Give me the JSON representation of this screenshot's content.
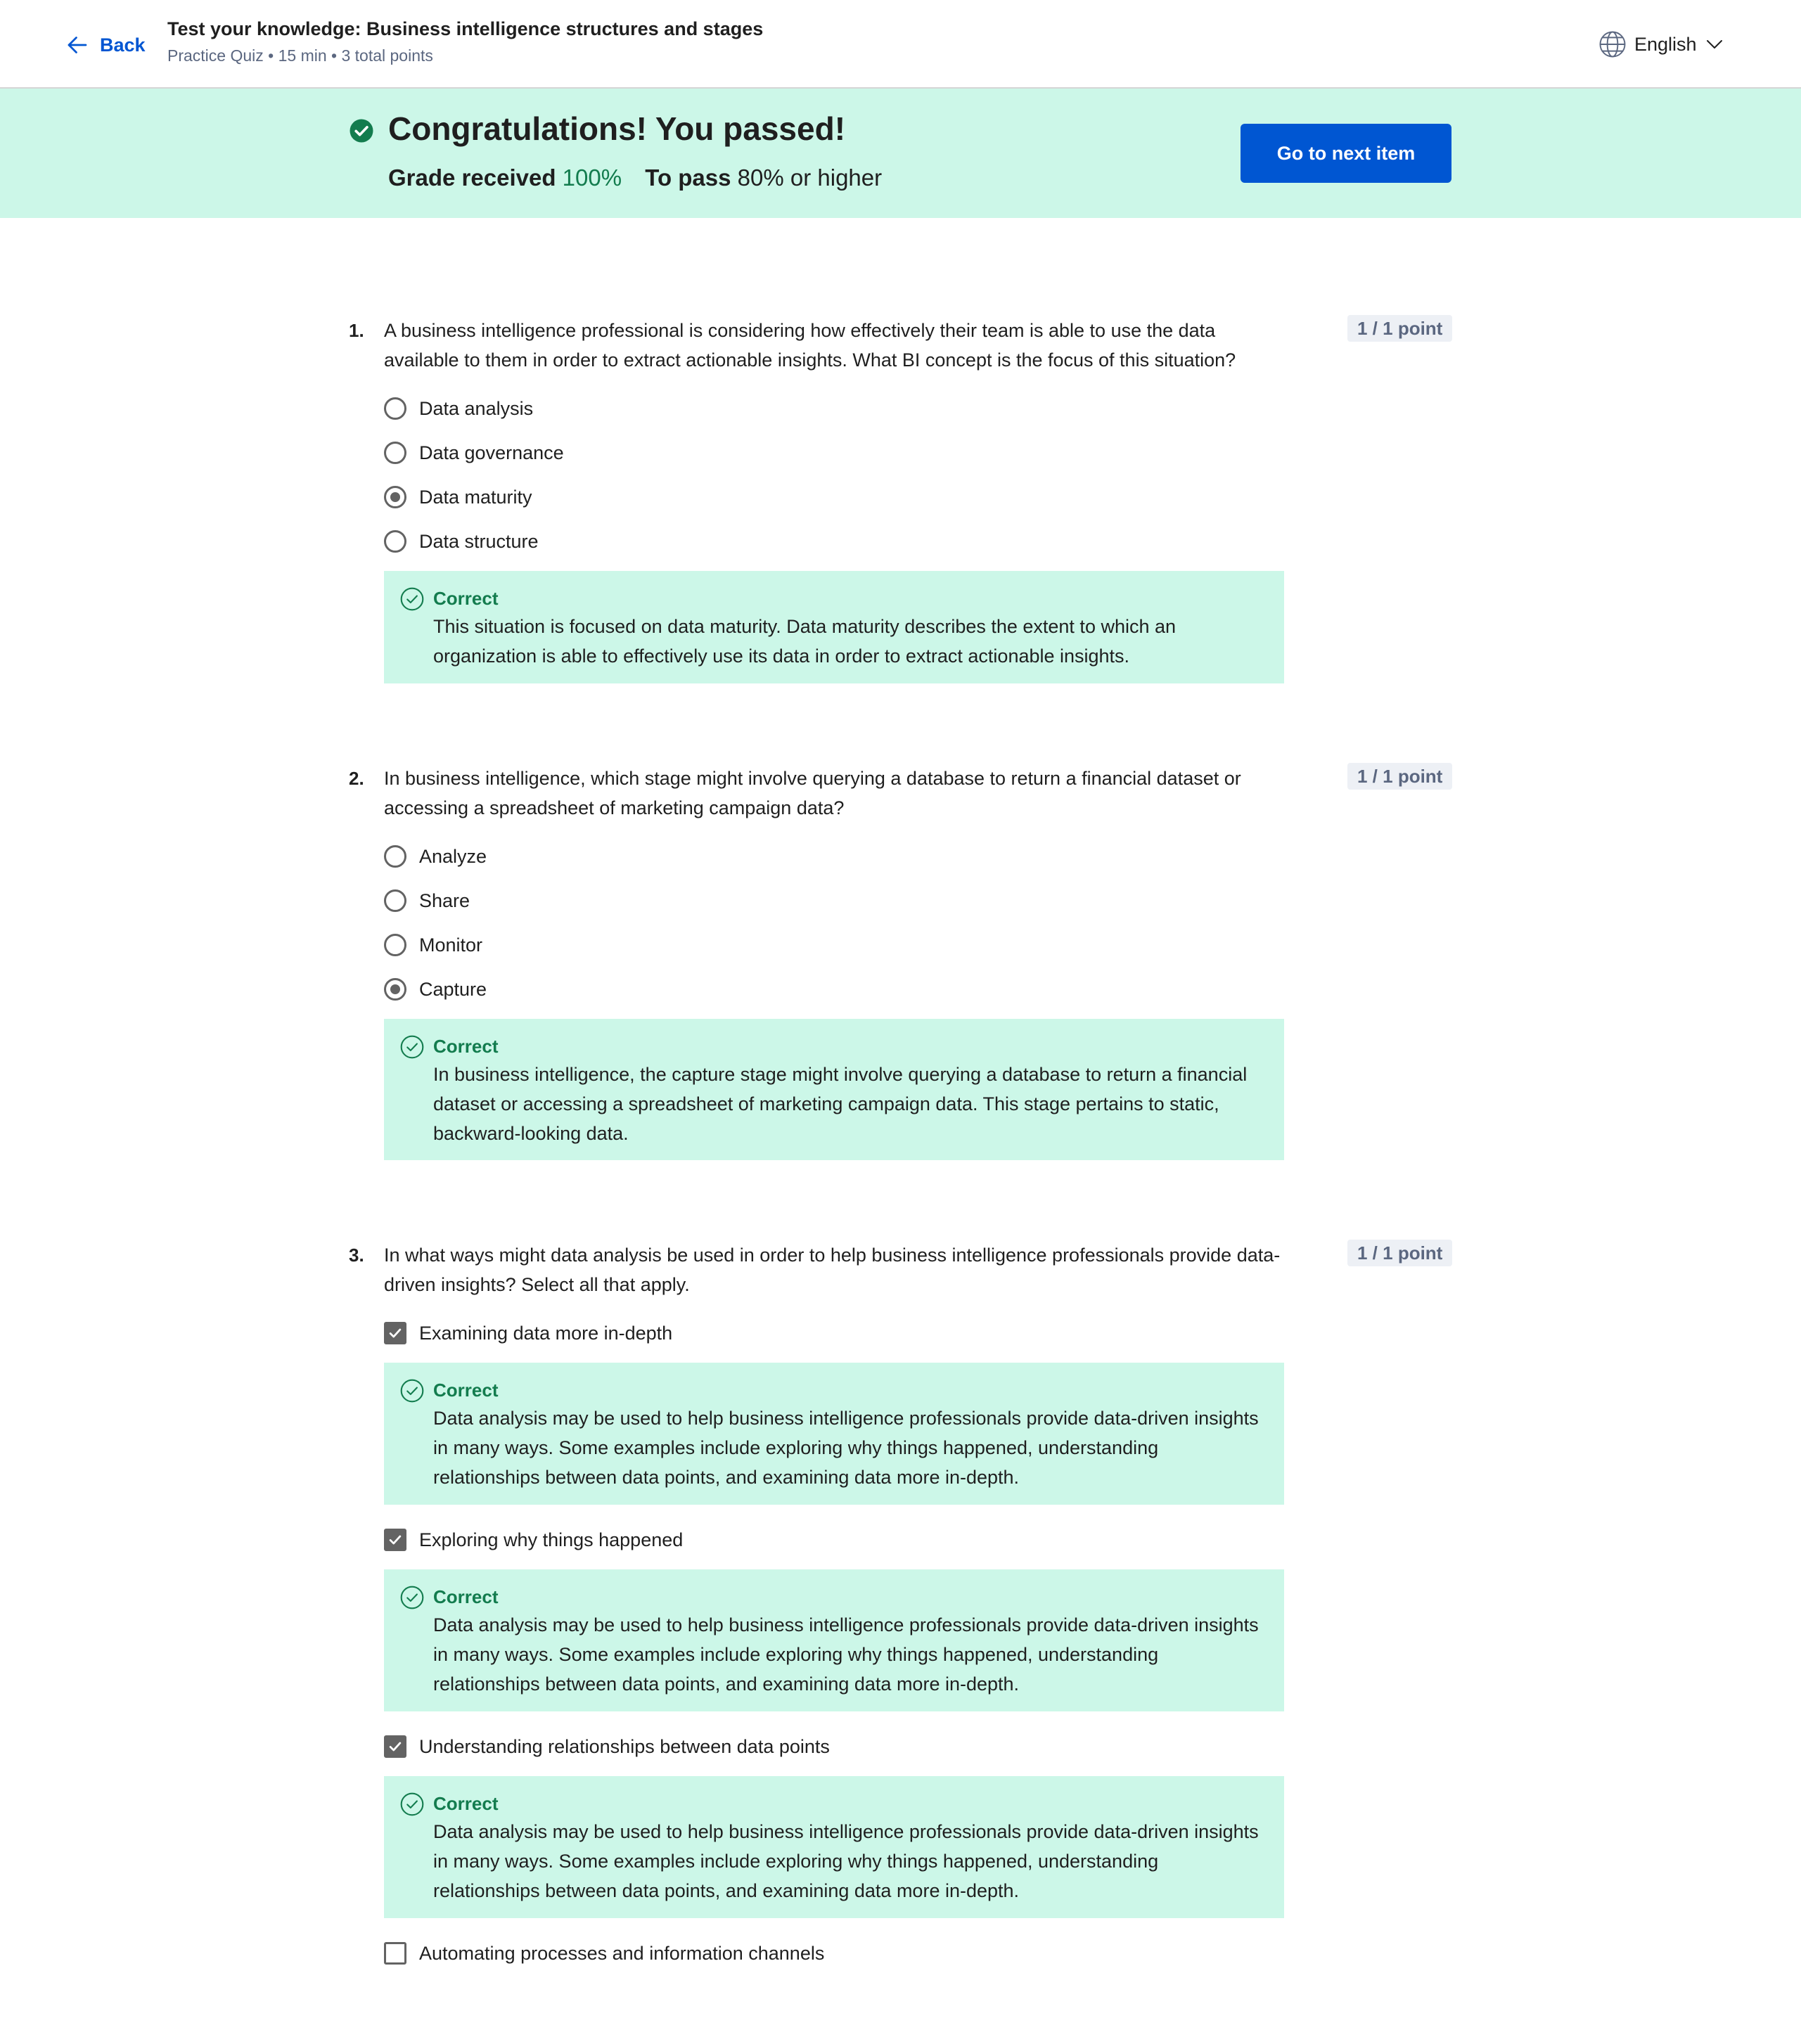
{
  "header": {
    "back_label": "Back",
    "title": "Test your knowledge: Business intelligence structures and stages",
    "meta": "Practice Quiz • 15 min • 3 total points",
    "language": "English"
  },
  "banner": {
    "title": "Congratulations! You passed!",
    "grade_label": "Grade received",
    "grade_value": "100%",
    "pass_label": "To pass",
    "pass_value": "80% or higher",
    "next_button": "Go to next item"
  },
  "colors": {
    "accent": "#0056d2",
    "success": "#137c4e",
    "success_bg": "#ccf7e8"
  },
  "questions": [
    {
      "number": "1.",
      "text": "A business intelligence professional is considering how effectively their team is able to use the data available to them in order to extract actionable insights. What BI concept is the focus of this situation?",
      "points": "1 / 1 point",
      "options": [
        {
          "label": "Data analysis",
          "selected": false
        },
        {
          "label": "Data governance",
          "selected": false
        },
        {
          "label": "Data maturity",
          "selected": true
        },
        {
          "label": "Data structure",
          "selected": false
        }
      ],
      "feedback": {
        "label": "Correct",
        "text": "This situation is focused on data maturity. Data maturity describes the extent to which an organization is able to effectively use its data in order to extract actionable insights."
      }
    },
    {
      "number": "2.",
      "text": "In business intelligence, which stage might involve querying a database to return a financial dataset or accessing a spreadsheet of marketing campaign data?",
      "points": "1 / 1 point",
      "options": [
        {
          "label": "Analyze",
          "selected": false
        },
        {
          "label": "Share",
          "selected": false
        },
        {
          "label": "Monitor",
          "selected": false
        },
        {
          "label": "Capture",
          "selected": true
        }
      ],
      "feedback": {
        "label": "Correct",
        "text": "In business intelligence, the capture stage might involve querying a database to return a financial dataset or accessing a spreadsheet of marketing campaign data. This stage pertains to static, backward-looking data."
      }
    },
    {
      "number": "3.",
      "text": "In what ways might data analysis be used in order to help business intelligence professionals provide data-driven insights? Select all that apply.",
      "points": "1 / 1 point",
      "options": [
        {
          "label": "Examining data more in-depth",
          "selected": true,
          "feedback": {
            "label": "Correct",
            "text": "Data analysis may be used to help business intelligence professionals provide data-driven insights in many ways. Some examples include exploring why things happened, understanding relationships between data points, and examining data more in-depth."
          }
        },
        {
          "label": "Exploring why things happened",
          "selected": true,
          "feedback": {
            "label": "Correct",
            "text": "Data analysis may be used to help business intelligence professionals provide data-driven insights in many ways. Some examples include exploring why things happened, understanding relationships between data points, and examining data more in-depth."
          }
        },
        {
          "label": "Understanding relationships between data points",
          "selected": true,
          "feedback": {
            "label": "Correct",
            "text": "Data analysis may be used to help business intelligence professionals provide data-driven insights in many ways. Some examples include exploring why things happened, understanding relationships between data points, and examining data more in-depth."
          }
        },
        {
          "label": "Automating processes and information channels",
          "selected": false
        }
      ]
    }
  ]
}
